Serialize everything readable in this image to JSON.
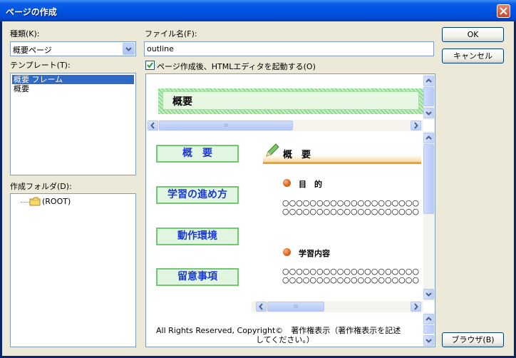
{
  "window": {
    "title": "ページの作成"
  },
  "left": {
    "kind_label": "種類(K):",
    "kind_value": "概要ページ",
    "template_label": "テンプレート(T):",
    "templates": [
      "概要 フレーム",
      "概要"
    ],
    "folder_label": "作成フォルダ(D):",
    "folder_root": "(ROOT)"
  },
  "form": {
    "filename_label": "ファイル名(F):",
    "filename_value": "outline",
    "checkbox_label": "ページ作成後、HTMLエディタを起動する(O)",
    "checkbox_checked": true
  },
  "buttons": {
    "ok": "OK",
    "cancel": "キャンセル",
    "browse": "ブラウザ(B)"
  },
  "preview": {
    "top_heading": "概要",
    "nav": [
      "概　要",
      "学習の進め方",
      "動作環境",
      "留意事項"
    ],
    "main_heading": "概　要",
    "sections": [
      {
        "title": "目　的",
        "lines": [
          "○○○○○○○○○○○○○○○○○○○○",
          "○○○○○○○○○○○○○○○○○○○○"
        ]
      },
      {
        "title": "学習内容",
        "lines": [
          "○○○○○○○○○○○○○○○○○○○○",
          "○○○○○○○○○○○○○○○○○○○○"
        ]
      }
    ],
    "footer_line1": "All Rights Reserved, Copyright©　著作権表示（著作権表示を記述",
    "footer_line2": "してください。）",
    "scroll_grip": "III"
  }
}
